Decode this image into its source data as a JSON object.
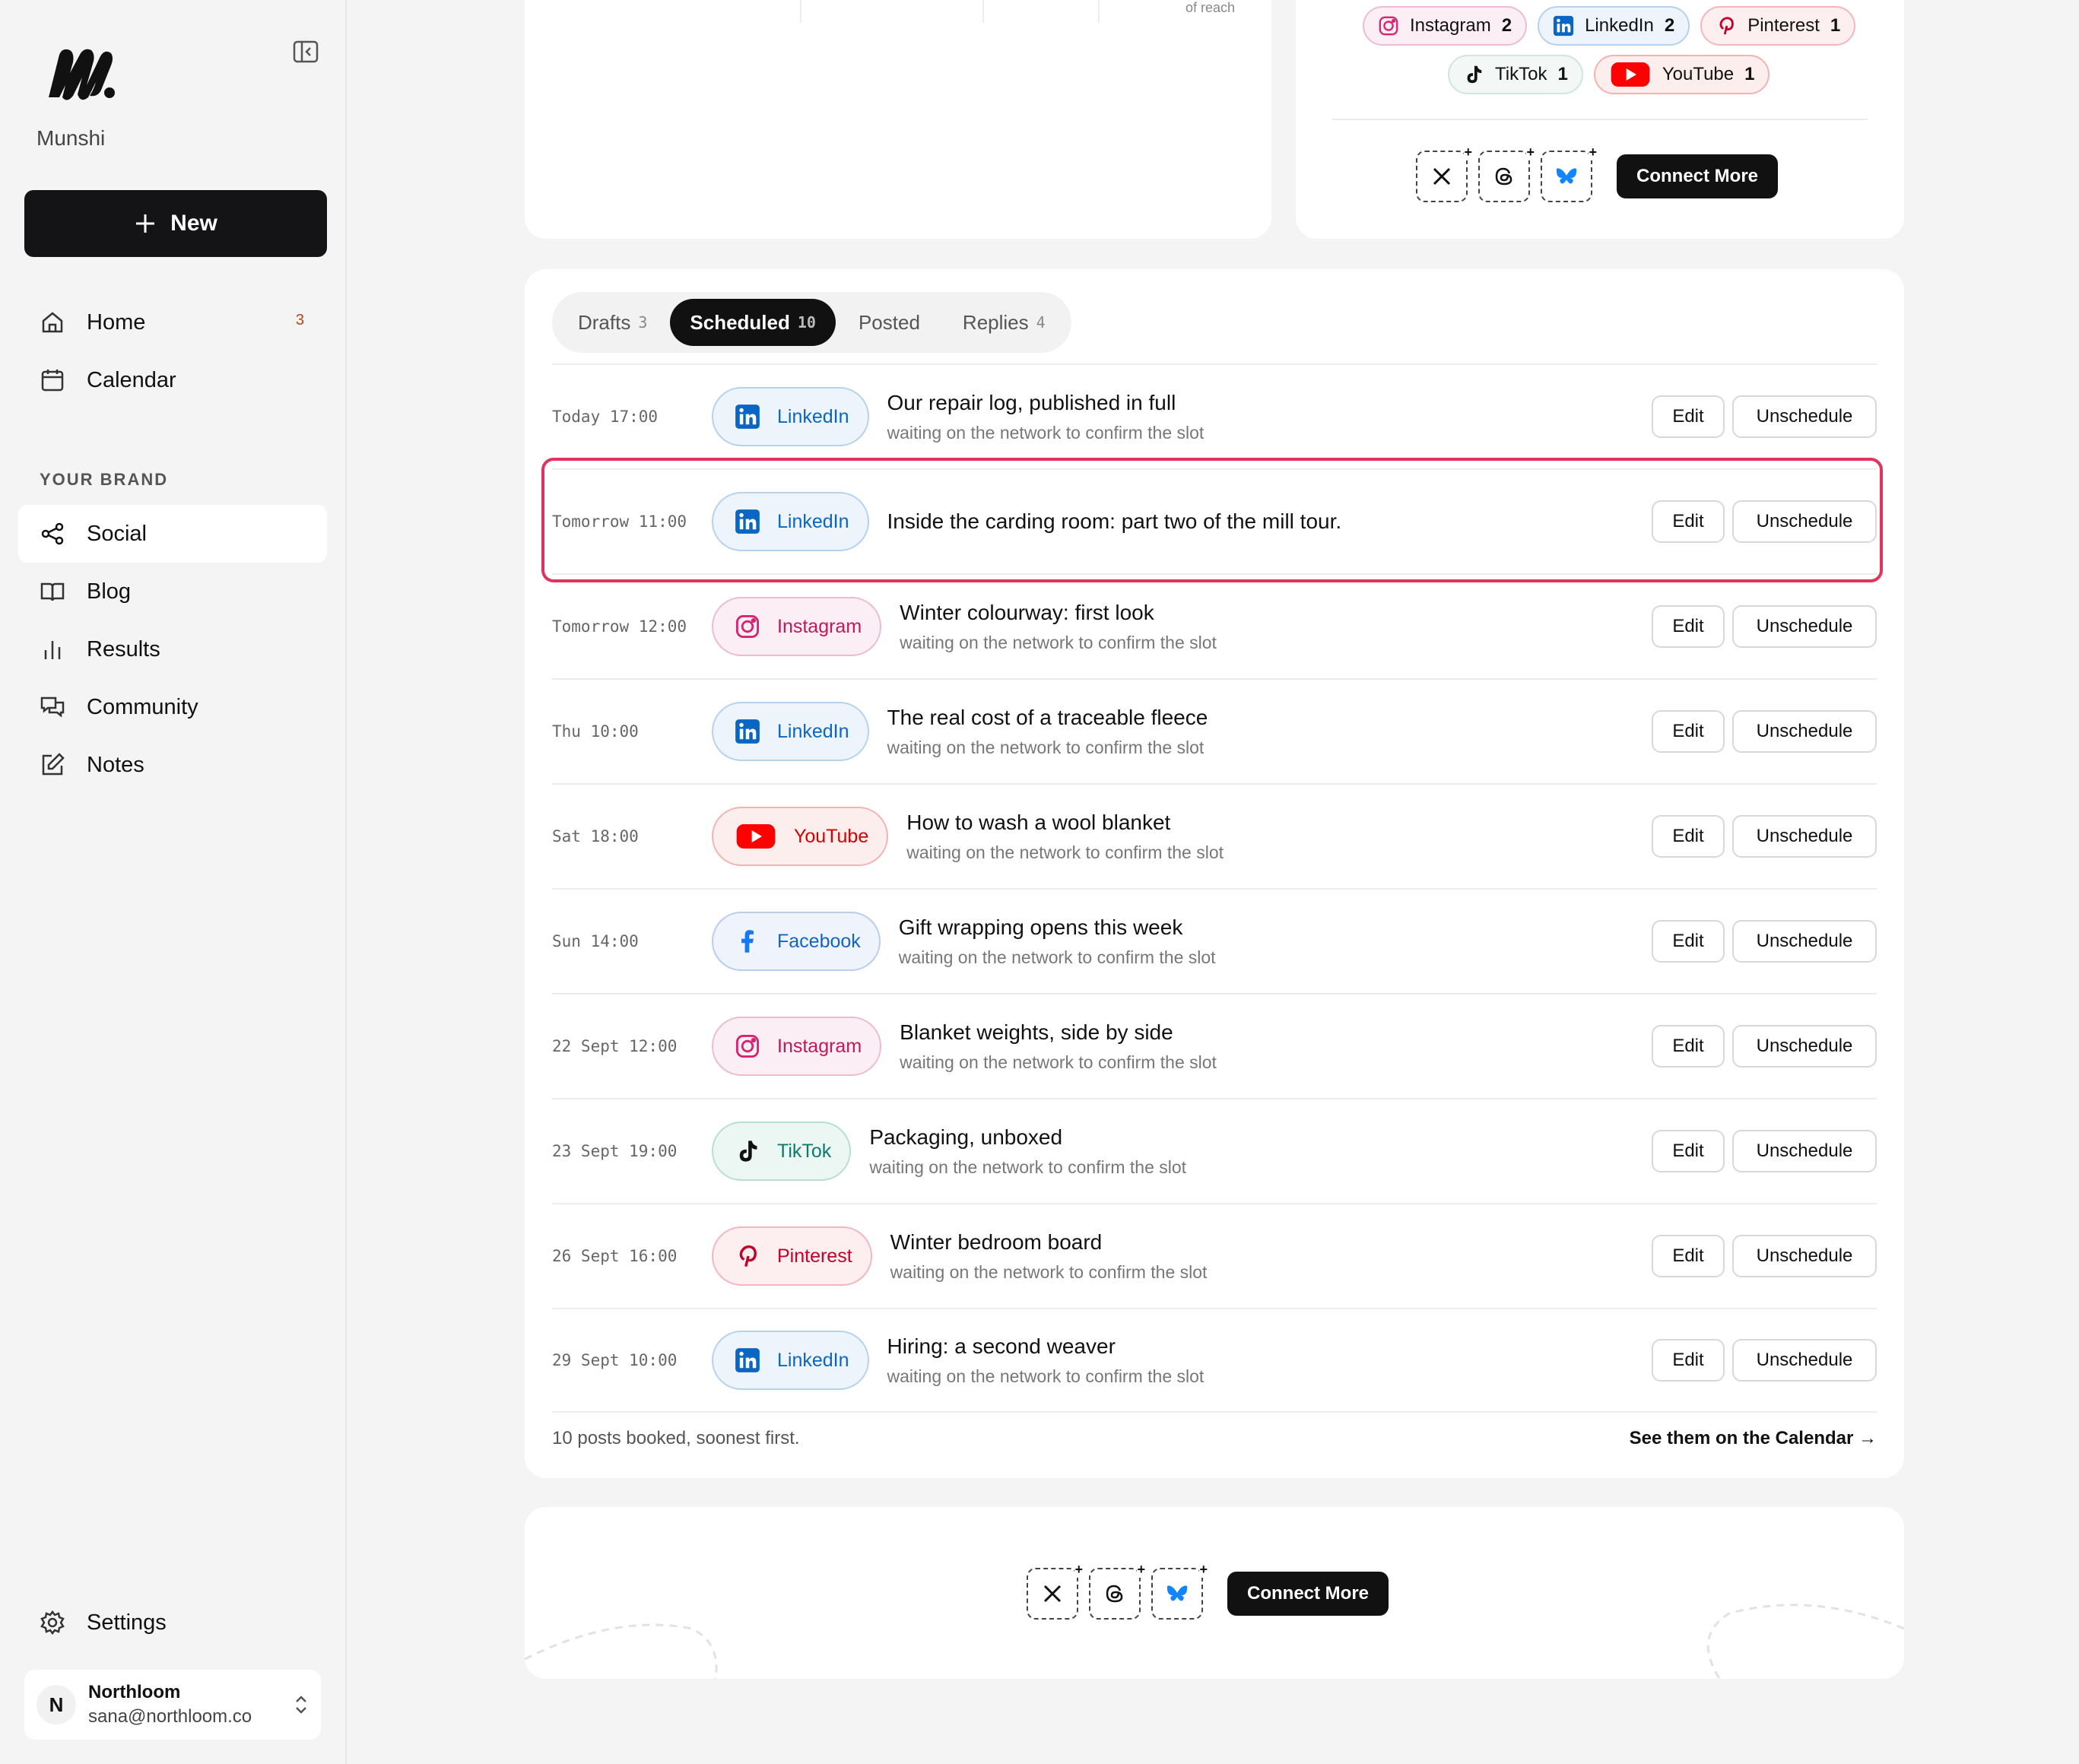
{
  "app": {
    "brand": "Munshi"
  },
  "sidebar": {
    "new_label": "New",
    "items": [
      {
        "label": "Home",
        "badge": "3",
        "icon": "home-icon"
      },
      {
        "label": "Calendar",
        "icon": "calendar-icon"
      }
    ],
    "section_label": "YOUR BRAND",
    "brand_items": [
      {
        "label": "Social",
        "icon": "share-icon",
        "active": true
      },
      {
        "label": "Blog",
        "icon": "book-icon"
      },
      {
        "label": "Results",
        "icon": "bar-chart-icon"
      },
      {
        "label": "Community",
        "icon": "chat-icon"
      },
      {
        "label": "Notes",
        "icon": "edit-icon"
      }
    ],
    "settings_label": "Settings",
    "account": {
      "initial": "N",
      "name": "Northloom",
      "email": "sana@northloom.co"
    }
  },
  "reach_panel": {
    "label": "of reach"
  },
  "connected": {
    "accounts": [
      {
        "name": "Instagram",
        "count": "2"
      },
      {
        "name": "LinkedIn",
        "count": "2"
      },
      {
        "name": "Pinterest",
        "count": "1"
      },
      {
        "name": "TikTok",
        "count": "1"
      },
      {
        "name": "YouTube",
        "count": "1"
      }
    ],
    "addable": [
      "x-icon",
      "threads-icon",
      "bluesky-icon"
    ],
    "connect_label": "Connect More"
  },
  "tabs": [
    {
      "label": "Drafts",
      "count": "3"
    },
    {
      "label": "Scheduled",
      "count": "10",
      "active": true
    },
    {
      "label": "Posted",
      "count": ""
    },
    {
      "label": "Replies",
      "count": "4"
    }
  ],
  "scheduled": [
    {
      "time": "Today 17:00",
      "network": "LinkedIn",
      "title": "Our repair log, published in full",
      "status": "waiting on the network to confirm the slot"
    },
    {
      "time": "Tomorrow 11:00",
      "network": "LinkedIn",
      "title": "Inside the carding room: part two of the mill tour.",
      "status": ""
    },
    {
      "time": "Tomorrow 12:00",
      "network": "Instagram",
      "title": "Winter colourway: first look",
      "status": "waiting on the network to confirm the slot"
    },
    {
      "time": "Thu 10:00",
      "network": "LinkedIn",
      "title": "The real cost of a traceable fleece",
      "status": "waiting on the network to confirm the slot"
    },
    {
      "time": "Sat 18:00",
      "network": "YouTube",
      "title": "How to wash a wool blanket",
      "status": "waiting on the network to confirm the slot"
    },
    {
      "time": "Sun 14:00",
      "network": "Facebook",
      "title": "Gift wrapping opens this week",
      "status": "waiting on the network to confirm the slot"
    },
    {
      "time": "22 Sept 12:00",
      "network": "Instagram",
      "title": "Blanket weights, side by side",
      "status": "waiting on the network to confirm the slot"
    },
    {
      "time": "23 Sept 19:00",
      "network": "TikTok",
      "title": "Packaging, unboxed",
      "status": "waiting on the network to confirm the slot"
    },
    {
      "time": "26 Sept 16:00",
      "network": "Pinterest",
      "title": "Winter bedroom board",
      "status": "waiting on the network to confirm the slot"
    },
    {
      "time": "29 Sept 10:00",
      "network": "LinkedIn",
      "title": "Hiring: a second weaver",
      "status": "waiting on the network to confirm the slot"
    }
  ],
  "row_actions": {
    "edit": "Edit",
    "unschedule": "Unschedule"
  },
  "list_footer": {
    "note": "10 posts booked, soonest first.",
    "link": "See them on the Calendar →"
  },
  "bottom_panel": {
    "connect_label": "Connect More"
  }
}
